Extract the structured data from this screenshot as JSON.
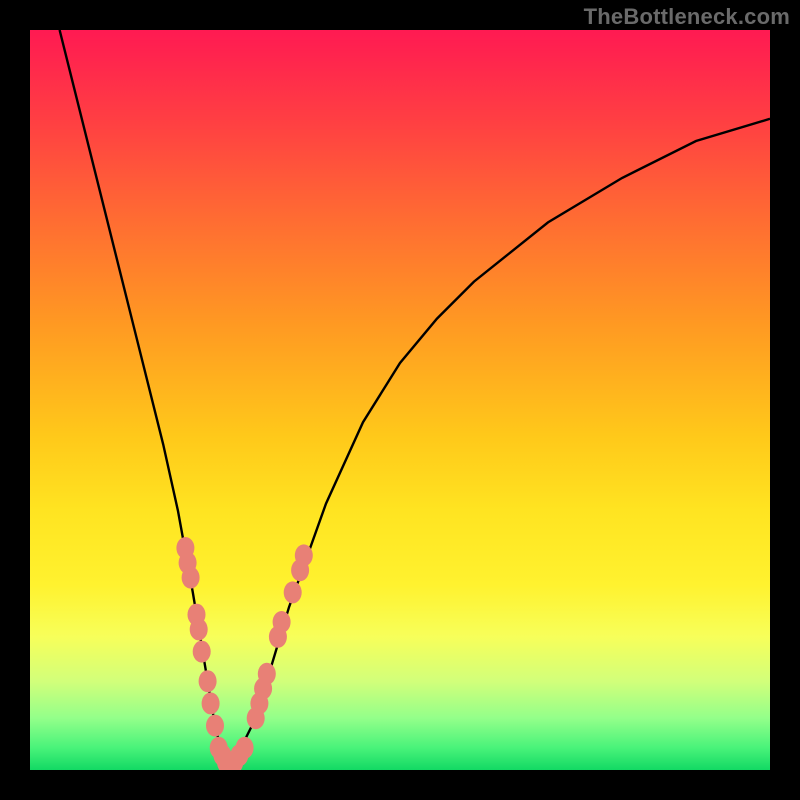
{
  "watermark": "TheBottleneck.com",
  "colors": {
    "frame": "#000000",
    "gradient_top": "#ff1a52",
    "gradient_mid": "#fff22f",
    "gradient_bottom": "#12d964",
    "curve": "#000000",
    "marker": "#e88076"
  },
  "chart_data": {
    "type": "line",
    "title": "",
    "xlabel": "",
    "ylabel": "",
    "xlim": [
      0,
      100
    ],
    "ylim": [
      0,
      100
    ],
    "grid": false,
    "legend": false,
    "series": [
      {
        "name": "bottleneck-curve",
        "x": [
          4,
          6,
          8,
          10,
          12,
          14,
          16,
          18,
          20,
          22,
          23,
          24,
          25,
          26,
          27,
          28,
          30,
          32,
          35,
          40,
          45,
          50,
          55,
          60,
          70,
          80,
          90,
          100
        ],
        "y": [
          100,
          92,
          84,
          76,
          68,
          60,
          52,
          44,
          35,
          24,
          18,
          12,
          6,
          2,
          1,
          2,
          6,
          12,
          22,
          36,
          47,
          55,
          61,
          66,
          74,
          80,
          85,
          88
        ]
      }
    ],
    "markers": [
      {
        "x": 21.0,
        "y": 30
      },
      {
        "x": 21.3,
        "y": 28
      },
      {
        "x": 21.7,
        "y": 26
      },
      {
        "x": 22.5,
        "y": 21
      },
      {
        "x": 22.8,
        "y": 19
      },
      {
        "x": 23.2,
        "y": 16
      },
      {
        "x": 24.0,
        "y": 12
      },
      {
        "x": 24.4,
        "y": 9
      },
      {
        "x": 25.0,
        "y": 6
      },
      {
        "x": 25.5,
        "y": 3
      },
      {
        "x": 26.0,
        "y": 2
      },
      {
        "x": 26.5,
        "y": 1
      },
      {
        "x": 27.0,
        "y": 1
      },
      {
        "x": 27.6,
        "y": 1
      },
      {
        "x": 28.3,
        "y": 2
      },
      {
        "x": 29.0,
        "y": 3
      },
      {
        "x": 30.5,
        "y": 7
      },
      {
        "x": 31.0,
        "y": 9
      },
      {
        "x": 31.5,
        "y": 11
      },
      {
        "x": 32.0,
        "y": 13
      },
      {
        "x": 33.5,
        "y": 18
      },
      {
        "x": 34.0,
        "y": 20
      },
      {
        "x": 35.5,
        "y": 24
      },
      {
        "x": 36.5,
        "y": 27
      },
      {
        "x": 37.0,
        "y": 29
      }
    ]
  }
}
